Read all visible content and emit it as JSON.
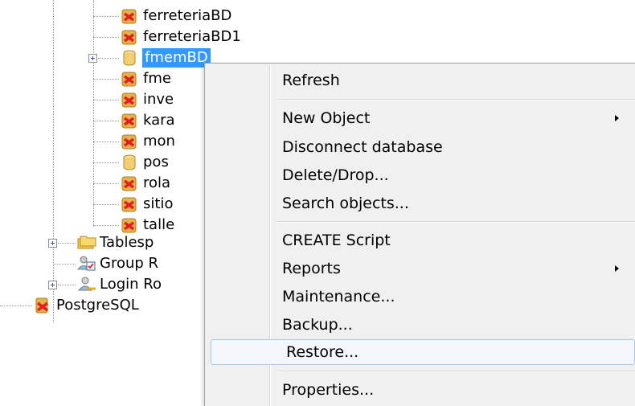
{
  "tree": {
    "databases": [
      {
        "label": "ferreteriaBD",
        "icon": "database-disconnected-icon"
      },
      {
        "label": "ferreteriaBD1",
        "icon": "database-disconnected-icon"
      },
      {
        "label": "fmemBD",
        "icon": "database-connected-icon",
        "selected": true
      },
      {
        "label": "fme",
        "icon": "database-disconnected-icon"
      },
      {
        "label": "inve",
        "icon": "database-disconnected-icon"
      },
      {
        "label": "kara",
        "icon": "database-disconnected-icon"
      },
      {
        "label": "mon",
        "icon": "database-disconnected-icon"
      },
      {
        "label": "pos",
        "icon": "database-connected-icon"
      },
      {
        "label": "rola",
        "icon": "database-disconnected-icon"
      },
      {
        "label": "sitio",
        "icon": "database-disconnected-icon"
      },
      {
        "label": "talle",
        "icon": "database-disconnected-icon"
      }
    ],
    "groups": [
      {
        "label": "Tablesp",
        "icon": "tablespaces-icon"
      },
      {
        "label": "Group R",
        "icon": "group-roles-icon"
      },
      {
        "label": "Login Ro",
        "icon": "login-roles-icon"
      }
    ],
    "server": {
      "label": "PostgreSQL",
      "icon": "server-disconnected-icon"
    }
  },
  "context_menu": {
    "items": [
      {
        "label": "Refresh"
      },
      {
        "label": "New Object",
        "submenu": true
      },
      {
        "label": "Disconnect database"
      },
      {
        "label": "Delete/Drop..."
      },
      {
        "label": "Search objects..."
      },
      {
        "label": "CREATE Script"
      },
      {
        "label": "Reports",
        "submenu": true
      },
      {
        "label": "Maintenance..."
      },
      {
        "label": "Backup..."
      },
      {
        "label": "Restore...",
        "hover": true
      },
      {
        "label": "Properties..."
      }
    ]
  },
  "colors": {
    "selection": "#3399ff",
    "menu_background": "#f0f0f0",
    "hover_border": "#a8c8ea"
  }
}
